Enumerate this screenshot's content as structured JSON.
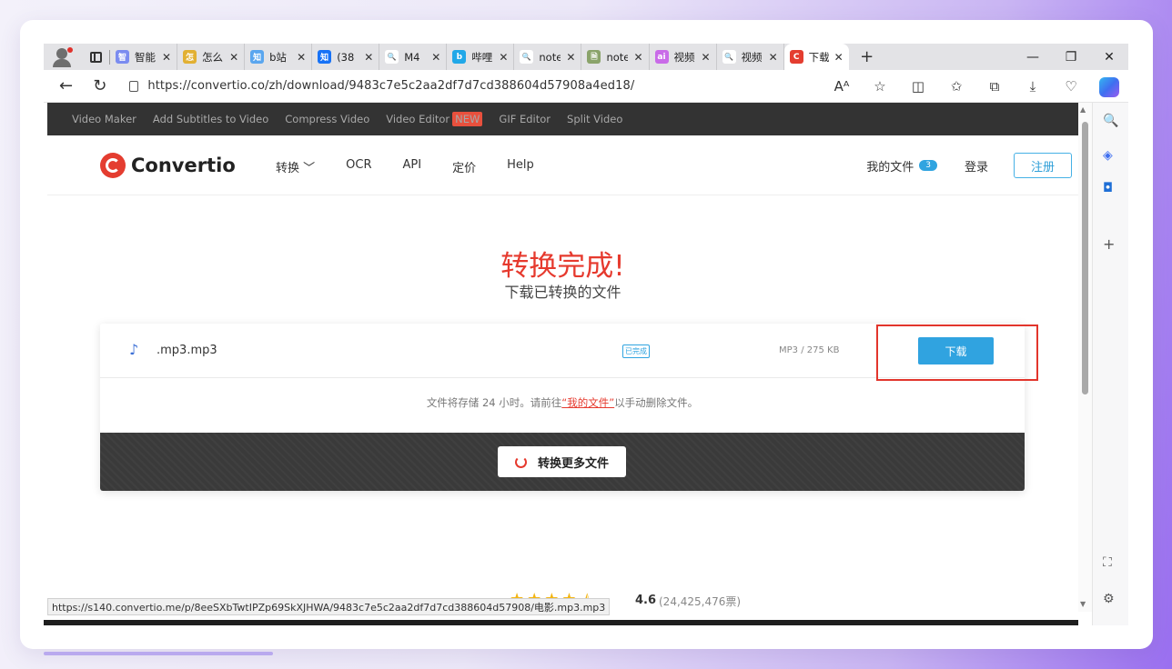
{
  "tabs": [
    {
      "title": "智能",
      "fav_text": "智",
      "fav_color": "#7b8cf0"
    },
    {
      "title": "怎么",
      "fav_text": "怎",
      "fav_color": "#e2b032"
    },
    {
      "title": "b站",
      "fav_text": "知",
      "fav_color": "#5aa6ef"
    },
    {
      "title": "(38",
      "fav_text": "知",
      "fav_color": "#1772f6"
    },
    {
      "title": "M4",
      "fav_text": "🔍",
      "fav_color": "#ffffff"
    },
    {
      "title": "哔哩",
      "fav_text": "b",
      "fav_color": "#21a8e8"
    },
    {
      "title": "note",
      "fav_text": "🔍",
      "fav_color": "#ffffff"
    },
    {
      "title": "note",
      "fav_text": "🗎",
      "fav_color": "#8aa36a"
    },
    {
      "title": "视频",
      "fav_text": "ai",
      "fav_color": "#c96be8"
    },
    {
      "title": "视频",
      "fav_text": "🔍",
      "fav_color": "#ffffff"
    },
    {
      "title": "下载",
      "fav_text": "C",
      "fav_color": "#e43d30",
      "active": true
    }
  ],
  "tab_close_glyph": "✕",
  "new_tab_glyph": "+",
  "window_controls": {
    "minimize": "—",
    "restore": "❐",
    "close": "✕"
  },
  "address_bar": {
    "url": "https://convertio.co/zh/download/9483c7e5c2aa2df7d7cd388604d57908a4ed18/"
  },
  "site": {
    "topbar_links": [
      "Video Maker",
      "Add Subtitles to Video",
      "Compress Video",
      "Video Editor",
      "GIF Editor",
      "Split Video"
    ],
    "new_badge": "NEW",
    "logo_text": "Convertio",
    "nav": {
      "convert": "转换 ﹀",
      "ocr": "OCR",
      "api": "API",
      "pricing": "定价",
      "help": "Help"
    },
    "my_files": "我的文件",
    "my_files_count": "3",
    "login": "登录",
    "signup": "注册"
  },
  "result": {
    "title": "转换完成!",
    "subtitle": "下载已转换的文件",
    "file_name": ".mp3.mp3",
    "status": "已完成",
    "file_info": "MP3 / 275 KB",
    "download_label": "下载",
    "store_note_pre": "文件将存储 24 小时。请前往",
    "store_note_link": "“我的文件”",
    "store_note_post": "以手动删除文件。",
    "convert_more": "转换更多文件"
  },
  "rating": {
    "value": "4.6",
    "votes": "(24,425,476票)"
  },
  "status_url": "https://s140.convertio.me/p/8eeSXbTwtIPZp69SkXJHWA/9483c7e5c2aa2df7d7cd388604d57908/电影.mp3.mp3",
  "colors": {
    "accent_red": "#e63a2e",
    "accent_blue": "#30a3e0",
    "highlight_box": "#e2352c"
  }
}
